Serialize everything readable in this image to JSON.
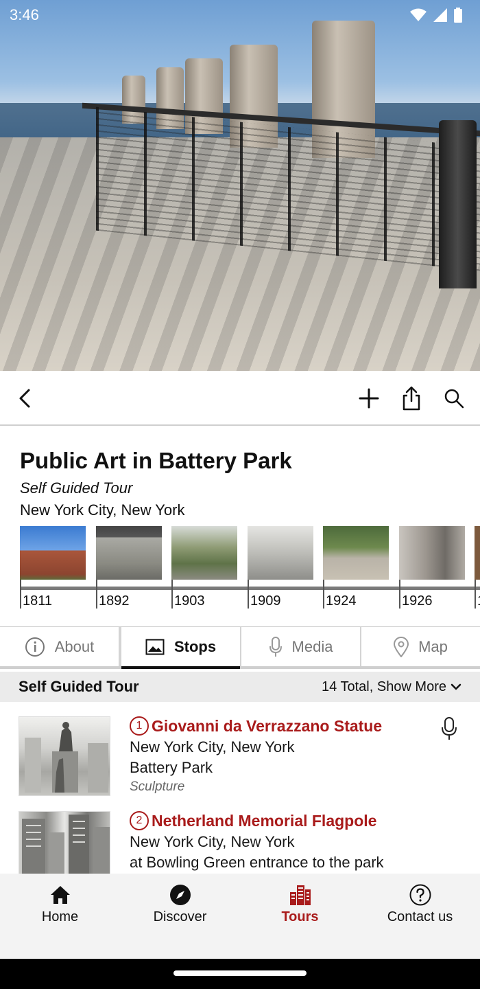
{
  "status_bar": {
    "time": "3:46",
    "icons": [
      "wifi-icon",
      "signal-icon",
      "battery-icon"
    ]
  },
  "hero": {
    "image": "hero-photo-battery-park-pier"
  },
  "toolbar": {
    "back_icon": "back-arrow-icon",
    "add_icon": "plus-icon",
    "share_icon": "share-icon",
    "search_icon": "search-icon"
  },
  "header": {
    "title": "Public Art in Battery Park",
    "subtitle": "Self Guided Tour",
    "location": "New York City, New York"
  },
  "timeline": {
    "items": [
      {
        "year": "1811",
        "color": "#a9563b"
      },
      {
        "year": "1892",
        "color": "#8a8a82"
      },
      {
        "year": "1903",
        "color": "#6f7f5a"
      },
      {
        "year": "1909",
        "color": "#bdbdb8"
      },
      {
        "year": "1924",
        "color": "#6e7c5e"
      },
      {
        "year": "1926",
        "color": "#9d9790"
      },
      {
        "year": "1",
        "color": "#7d5a3d"
      }
    ]
  },
  "tabs": [
    {
      "label": "About",
      "icon": "info-icon"
    },
    {
      "label": "Stops",
      "icon": "image-icon",
      "active": true
    },
    {
      "label": "Media",
      "icon": "microphone-icon"
    },
    {
      "label": "Map",
      "icon": "map-pin-icon"
    }
  ],
  "section": {
    "title": "Self Guided Tour",
    "more": "14 Total, Show More"
  },
  "stops": [
    {
      "number": "1",
      "title": "Giovanni da Verrazzano Statue",
      "line1": "New York City, New York",
      "line2": "Battery Park",
      "category": "Sculpture",
      "has_audio": true
    },
    {
      "number": "2",
      "title": "Netherland Memorial Flagpole",
      "line1": "New York City, New York",
      "line2": "at Bowling Green entrance to the park",
      "category": "",
      "has_audio": false
    }
  ],
  "bottom_nav": [
    {
      "label": "Home",
      "icon": "home-icon"
    },
    {
      "label": "Discover",
      "icon": "compass-icon"
    },
    {
      "label": "Tours",
      "icon": "city-icon",
      "active": true
    },
    {
      "label": "Contact us",
      "icon": "help-icon"
    }
  ],
  "colors": {
    "accent": "#a91b1b",
    "section_bg": "#ebebeb",
    "nav_bg": "#f3f3f3"
  }
}
